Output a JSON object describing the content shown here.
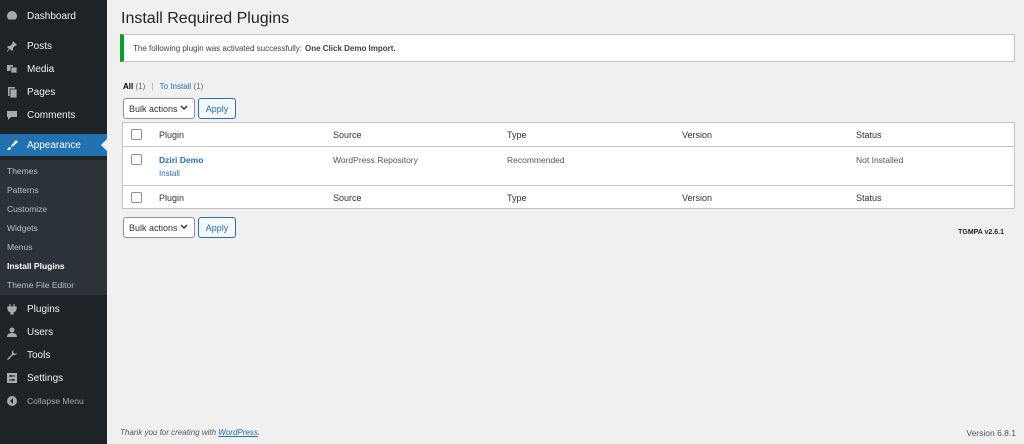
{
  "sidebar": {
    "items": [
      {
        "label": "Dashboard",
        "icon": "dashboard-icon"
      },
      {
        "label": "Posts",
        "icon": "pin-icon"
      },
      {
        "label": "Media",
        "icon": "media-icon"
      },
      {
        "label": "Pages",
        "icon": "pages-icon"
      },
      {
        "label": "Comments",
        "icon": "comments-icon"
      },
      {
        "label": "Appearance",
        "icon": "brush-icon"
      },
      {
        "label": "Plugins",
        "icon": "plugin-icon"
      },
      {
        "label": "Users",
        "icon": "users-icon"
      },
      {
        "label": "Tools",
        "icon": "wrench-icon"
      },
      {
        "label": "Settings",
        "icon": "settings-icon"
      }
    ],
    "submenu": [
      "Themes",
      "Patterns",
      "Customize",
      "Widgets",
      "Menus",
      "Install Plugins",
      "Theme File Editor"
    ],
    "collapse_label": "Collapse Menu",
    "active_color": "#2271b1"
  },
  "page": {
    "title": "Install Required Plugins",
    "notice_text": "The following plugin was activated successfully:",
    "notice_plugin": "One Click Demo Import."
  },
  "filters": {
    "all_label": "All",
    "all_count": "(1)",
    "sep": "|",
    "to_install_label": "To Install",
    "to_install_count": "(1)"
  },
  "actions": {
    "bulk_label": "Bulk actions",
    "apply_label": "Apply"
  },
  "table": {
    "columns": [
      "Plugin",
      "Source",
      "Type",
      "Version",
      "Status"
    ],
    "rows": [
      {
        "plugin": "Dziri Demo",
        "action": "Install",
        "source": "WordPress Repository",
        "type": "Recommended",
        "version": "",
        "status": "Not Installed"
      }
    ]
  },
  "tgmpa_version": "TGMPA v2.6.1",
  "footer": {
    "thanks_prefix": "Thank you for creating with",
    "thanks_link": "WordPress",
    "thanks_suffix": ".",
    "version": "Version 6.8.1"
  }
}
